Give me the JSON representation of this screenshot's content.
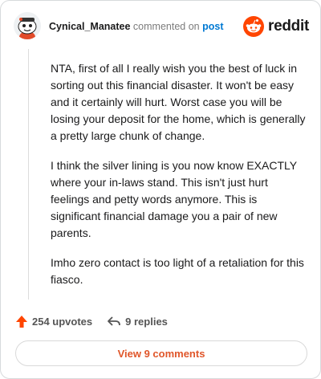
{
  "header": {
    "username": "Cynical_Manatee",
    "action_text": "commented on",
    "post_link": "post",
    "brand_name": "reddit",
    "brand_color": "#ff4500"
  },
  "comment": {
    "paragraphs": [
      "NTA, first of all I really wish you the best of luck in sorting out this financial disaster. It won't be easy and it certainly will hurt. Worst case you will be losing your deposit for the home, which is generally a pretty large chunk of change.",
      "I think the silver lining is you now know EXACTLY where your in-laws stand. This isn't just hurt feelings and petty words anymore. This is significant financial damage you a pair of new parents.",
      "Imho zero contact is too light of a retaliation for this fiasco."
    ]
  },
  "actions": {
    "upvotes_label": "254 upvotes",
    "replies_label": "9 replies",
    "upvote_icon": "upvote-arrow-icon",
    "reply_icon": "reply-arrow-icon",
    "upvote_color": "#ff4500"
  },
  "footer": {
    "view_comments_label": "View 9 comments",
    "accent_color": "#e0562a"
  }
}
